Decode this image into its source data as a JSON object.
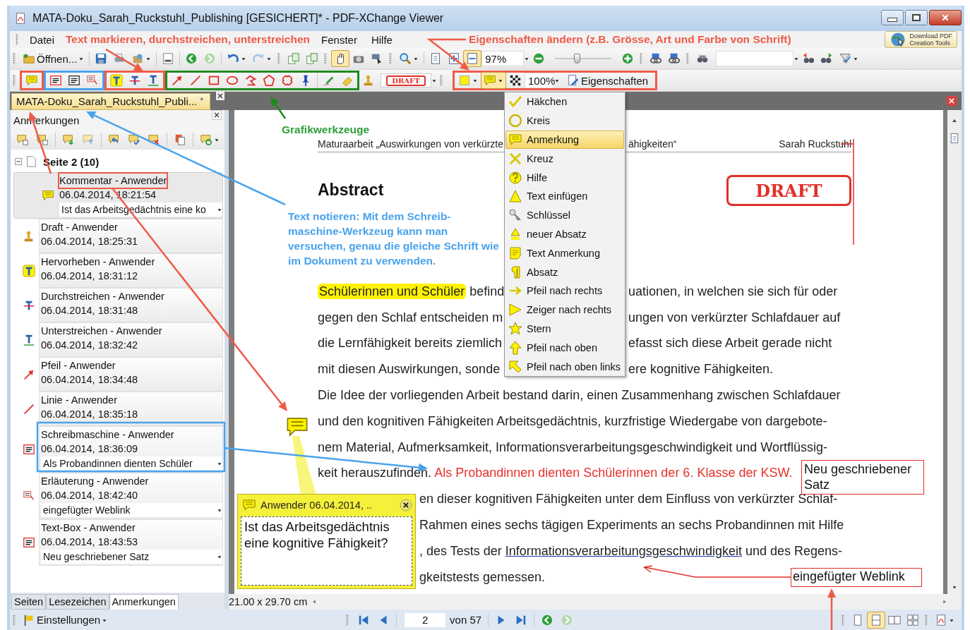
{
  "window": {
    "title": "MATA-Doku_Sarah_Ruckstuhl_Publishing [GESICHERT]* - PDF-XChange Viewer"
  },
  "menu_bar": [
    {
      "kind": "menu",
      "label": "Datei"
    },
    {
      "kind": "callout",
      "label": "Text markieren, durchstreichen, unterstreichen"
    },
    {
      "kind": "menu",
      "label": "Fenster"
    },
    {
      "kind": "menu",
      "label": "Hilfe"
    },
    {
      "kind": "callout",
      "label": "Eigenschaften ändern (z.B. Grösse, Art und Farbe von Schrift)"
    }
  ],
  "promo": {
    "line_1": "Download PDF",
    "line_2": "Creation Tools"
  },
  "toolbar": {
    "open_label": "Öffnen...",
    "zoom": "97%",
    "zoom_slider": {
      "level": 0.38
    }
  },
  "toolbar_2": {
    "stamp": "DRAFT",
    "opacity": "100%",
    "properties": "Eigenschaften"
  },
  "doc_tab": {
    "title": "MATA-Doku_Sarah_Ruckstuhl_Publi...",
    "modified": "*"
  },
  "panel": {
    "title": "Anmerkungen",
    "tree": [
      {
        "label": "Seite 2 (10)",
        "expanded": true,
        "children": [
          {
            "kind": "comment",
            "label": "Kommentar - Anwender",
            "date": "06.04.2014, 18:21:54",
            "comment": "Ist das Arbeitsgedächtnis eine ko",
            "selected": true
          },
          {
            "kind": "stamp",
            "label": "Draft - Anwender",
            "date": "06.04.2014, 18:25:31",
            "selected": false
          },
          {
            "kind": "highlight",
            "label": "Hervorheben - Anwender",
            "date": "06.04.2014, 18:31:12",
            "selected": false
          },
          {
            "kind": "strikeout",
            "label": "Durchstreichen - Anwender",
            "date": "06.04.2014, 18:31:48",
            "selected": false
          },
          {
            "kind": "underline",
            "label": "Unterstreichen - Anwender",
            "date": "06.04.2014, 18:32:42",
            "selected": false
          },
          {
            "kind": "arrow",
            "label": "Pfeil - Anwender",
            "date": "06.04.2014, 18:34:48",
            "selected": false
          },
          {
            "kind": "line",
            "label": "Linie - Anwender",
            "date": "06.04.2014, 18:35:18",
            "selected": false
          },
          {
            "kind": "typewriter",
            "label": "Schreibmaschine - Anwender",
            "date": "06.04.2014, 18:36:09",
            "comment": "Als Probandinnen dienten Schüler",
            "selected": false
          },
          {
            "kind": "callout",
            "label": "Erläuterung - Anwender",
            "date": "06.04.2014, 18:42:40",
            "comment": "eingefügter Weblink",
            "selected": false
          },
          {
            "kind": "textbox",
            "label": "Text-Box - Anwender",
            "date": "06.04.2014, 18:43:53",
            "comment": "Neu geschriebener Satz",
            "selected": false
          }
        ]
      }
    ],
    "tabs": [
      {
        "label": "Seiten",
        "selected": false
      },
      {
        "label": "Lesezeichen",
        "selected": false
      },
      {
        "label": "Anmerkungen",
        "selected": true
      }
    ]
  },
  "settings": "Einstellungen",
  "page_size": "21.00 x 29.70 cm",
  "navigation": {
    "page": "2",
    "page_count": "von 57"
  },
  "document": {
    "header_left": "Maturaarbeit „Auswirkungen von verkürzte",
    "header_right_part": "ähigkeiten“",
    "author": "Sarah Ruckstuhl",
    "stamp": "DRAFT",
    "heading": "Abstract",
    "lines": [
      {
        "left": [
          {
            "kind": "highlight",
            "text": "Schülerinnen und Schüler"
          },
          {
            "kind": "text",
            "text": " befind"
          }
        ],
        "right": [
          {
            "kind": "text",
            "text": "uationen, in welchen sie sich für oder"
          }
        ]
      },
      {
        "left": [
          {
            "kind": "text",
            "text": "gegen den Schlaf entscheiden m"
          }
        ],
        "right": [
          {
            "kind": "text",
            "text": "ungen von verkürzter Schlafdauer auf"
          }
        ]
      },
      {
        "left": [
          {
            "kind": "text",
            "text": "die Lernfähigkeit bereits ziemlich"
          }
        ],
        "right": [
          {
            "kind": "text",
            "text": "efasst sich diese Arbeit gerade nicht"
          }
        ]
      },
      {
        "left": [
          {
            "kind": "text",
            "text": "mit diesen Auswirkungen, sonde"
          }
        ],
        "right": [
          {
            "kind": "text",
            "text": "ere kognitive Fähigkeiten."
          }
        ]
      },
      {
        "left": [
          {
            "kind": "text",
            "text": "Die Idee der vorliegenden Arbeit bestand darin, einen Zusammenhang zwischen Schlafdauer"
          }
        ]
      },
      {
        "left": [
          {
            "kind": "text",
            "text": "und den kognitiven Fähigkeiten Arbeitsgedächtnis, kurzfristige Wiedergabe von dargebote-"
          }
        ]
      },
      {
        "left": [
          {
            "kind": "text",
            "text": "nem Material, Aufmerksamkeit, Informationsverarbeitungsgeschwindigkeit und Wortflüssig-"
          }
        ]
      },
      {
        "left": [
          {
            "kind": "text",
            "text": "keit herauszufinden. "
          },
          {
            "kind": "typewriter",
            "text": "Als Probandinnen dienten Schülerinnen der 6. Klasse der KSW."
          }
        ]
      },
      {
        "after_note": [
          {
            "kind": "text",
            "text": "en dieser kognitiven Fähigkeiten unter dem Einfluss von verkürzter Schlaf-"
          }
        ]
      },
      {
        "after_note": [
          {
            "kind": "text",
            "text": "Rahmen eines sechs tägigen Experiments an sechs Probandinnen mit Hilfe"
          }
        ]
      },
      {
        "after_note": [
          {
            "kind": "text",
            "text": ", des Tests der "
          },
          {
            "kind": "weblink",
            "text": "Informationsverarbeitungsgeschwindigkeit"
          },
          {
            "kind": "text",
            "text": " und des Regens-"
          }
        ]
      },
      {
        "after_note": [
          {
            "kind": "text",
            "text": "gkeitstests gemessen."
          }
        ]
      }
    ],
    "textbox": "Neu geschriebener Satz",
    "callout": "eingefügter Weblink",
    "note": {
      "header": "Anwender 06.04.2014, ..",
      "text": "Ist das Arbeitsgedächtnis eine kognitive Fähigkeit?"
    }
  },
  "tutorial": {
    "graphics_label": "Grafikwerkzeuge",
    "typewriter_label": "Text notieren: Mit dem Schreib-maschine-Werkzeug kann man versuchen, genau die gleiche Schrift wie im Dokument zu verwenden."
  },
  "stamp_menu": {
    "items": [
      {
        "label": "Häkchen",
        "selected": false
      },
      {
        "label": "Kreis",
        "selected": false
      },
      {
        "label": "Anmerkung",
        "selected": true
      },
      {
        "label": "Kreuz",
        "selected": false
      },
      {
        "label": "Hilfe",
        "selected": false
      },
      {
        "label": "Text einfügen",
        "selected": false
      },
      {
        "label": "Schlüssel",
        "selected": false
      },
      {
        "label": "neuer Absatz",
        "selected": false
      },
      {
        "label": "Text Anmerkung",
        "selected": false
      },
      {
        "label": "Absatz",
        "selected": false
      },
      {
        "label": "Pfeil nach rechts",
        "selected": false
      },
      {
        "label": "Zeiger nach rechts",
        "selected": false
      },
      {
        "label": "Stern",
        "selected": false
      },
      {
        "label": "Pfeil nach oben",
        "selected": false
      },
      {
        "label": "Pfeil nach oben links",
        "selected": false
      }
    ]
  }
}
